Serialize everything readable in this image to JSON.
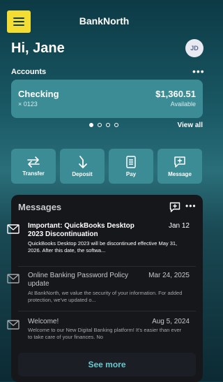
{
  "header": {
    "title": "BankNorth",
    "menu_icon": "hamburger-menu-icon",
    "menu_highlight_color": "#f4dd33"
  },
  "greeting": "Hi, Jane",
  "avatar_initials": "JD",
  "accounts": {
    "label": "Accounts",
    "more": "•••",
    "items": [
      {
        "name": "Checking",
        "number": "× 0123",
        "balance": "$1,360.51",
        "balance_label": "Available"
      }
    ],
    "page_count": 4,
    "active_page": 1,
    "view_all": "View all"
  },
  "quick_actions": [
    {
      "label": "Transfer",
      "icon": "transfer-arrows-icon"
    },
    {
      "label": "Deposit",
      "icon": "deposit-arrow-icon"
    },
    {
      "label": "Pay",
      "icon": "bill-icon"
    },
    {
      "label": "Message",
      "icon": "chat-plus-icon"
    }
  ],
  "messages": {
    "title": "Messages",
    "compose_icon": "compose-message-icon",
    "more": "•••",
    "items": [
      {
        "subject": "Important: QuickBooks Desktop 2023 Discontinuation",
        "date": "Jan 12",
        "body": "QuickBooks Desktop 2023 will be discontinued effective May 31, 2026. After this date, the softwa...",
        "unread": true
      },
      {
        "subject": "Online Banking Password Policy update",
        "date": "Mar 24, 2025",
        "body": "At BankNorth, we value the security of your information. For added protection, we've updated o...",
        "unread": false
      },
      {
        "subject": "Welcome!",
        "date": "Aug 5, 2024",
        "body": "Welcome to our New Digital Banking platform! It's easier than ever to take care of your finances. No",
        "unread": false
      }
    ],
    "see_more": "See more"
  },
  "colors": {
    "accent": "#3c8c95",
    "link": "#6cc8d2",
    "panel": "#16171b"
  }
}
